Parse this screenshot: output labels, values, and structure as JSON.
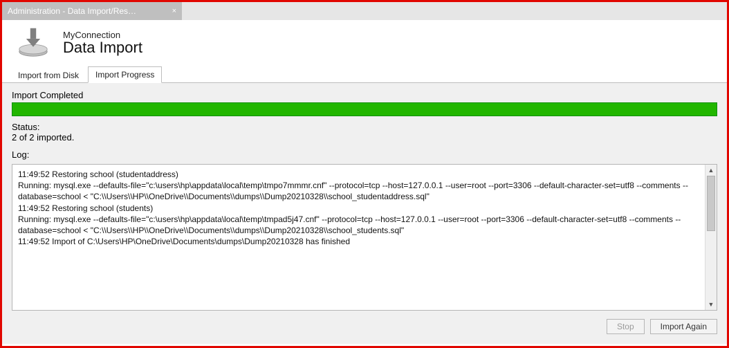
{
  "window_tab": {
    "title": "Administration - Data Import/Res…",
    "close_glyph": "×"
  },
  "header": {
    "connection": "MyConnection",
    "title": "Data Import"
  },
  "inner_tabs": {
    "items": [
      {
        "label": "Import from Disk",
        "active": false
      },
      {
        "label": "Import Progress",
        "active": true
      }
    ]
  },
  "progress": {
    "label": "Import Completed",
    "percent": 100,
    "color": "#22b600",
    "status_label": "Status:",
    "status_value": "2 of 2 imported."
  },
  "log": {
    "label": "Log:",
    "lines": [
      "11:49:52 Restoring school (studentaddress)",
      "Running: mysql.exe --defaults-file=\"c:\\users\\hp\\appdata\\local\\temp\\tmpo7mmmr.cnf\"  --protocol=tcp --host=127.0.0.1 --user=root --port=3306 --default-character-set=utf8 --comments --database=school < \"C:\\\\Users\\\\HP\\\\OneDrive\\\\Documents\\\\dumps\\\\Dump20210328\\\\school_studentaddress.sql\"",
      "11:49:52 Restoring school (students)",
      "Running: mysql.exe --defaults-file=\"c:\\users\\hp\\appdata\\local\\temp\\tmpad5j47.cnf\"  --protocol=tcp --host=127.0.0.1 --user=root --port=3306 --default-character-set=utf8 --comments --database=school < \"C:\\\\Users\\\\HP\\\\OneDrive\\\\Documents\\\\dumps\\\\Dump20210328\\\\school_students.sql\"",
      "11:49:52 Import of C:\\Users\\HP\\OneDrive\\Documents\\dumps\\Dump20210328 has finished"
    ]
  },
  "buttons": {
    "stop": {
      "label": "Stop",
      "enabled": false
    },
    "again": {
      "label": "Import Again",
      "enabled": true
    }
  }
}
